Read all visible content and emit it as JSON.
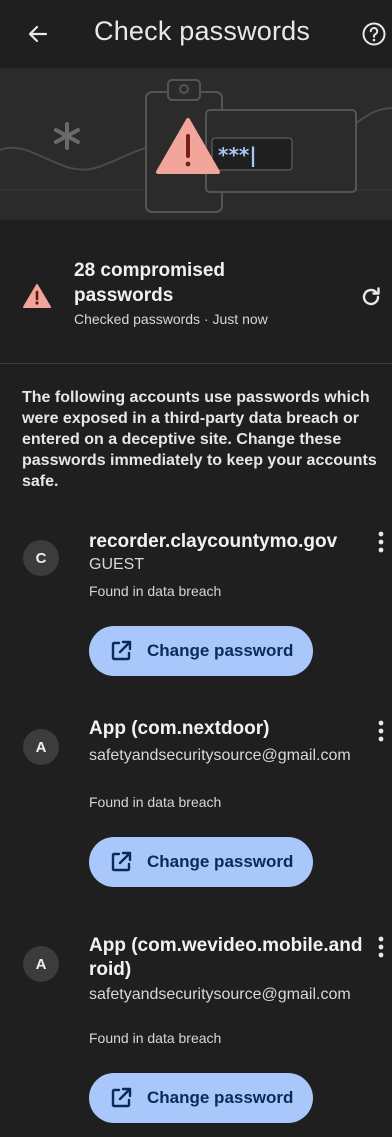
{
  "header": {
    "title": "Check passwords",
    "back_icon": "arrow-left-icon",
    "help_icon": "help-circle-icon"
  },
  "illustration": {
    "password_mask": "***|"
  },
  "summary": {
    "title": "28 compromised passwords",
    "subtitle": "Checked passwords · Just now",
    "warning_icon": "warning-triangle-icon",
    "refresh_icon": "refresh-icon"
  },
  "description": "The following accounts use passwords which were exposed in a third-party data breach or entered on a deceptive site. Change these passwords immediately to keep your accounts safe.",
  "colors": {
    "background": "#1f1f1f",
    "warning": "#f2a59a",
    "button_bg": "#a9c7fa",
    "button_text": "#0b2a57"
  },
  "entries": [
    {
      "initial": "C",
      "site": "recorder.claycountymo.gov",
      "username": "GUEST",
      "status": "Found in data breach",
      "button_label": "Change password"
    },
    {
      "initial": "A",
      "site": "App (com.nextdoor)",
      "username": "safetyandsecuritysource@gmail.com",
      "status": "Found in data breach",
      "button_label": "Change password"
    },
    {
      "initial": "A",
      "site": "App (com.wevideo.mobile.android)",
      "username": "safetyandsecuritysource@gmail.com",
      "status": "Found in data breach",
      "button_label": "Change password"
    }
  ]
}
